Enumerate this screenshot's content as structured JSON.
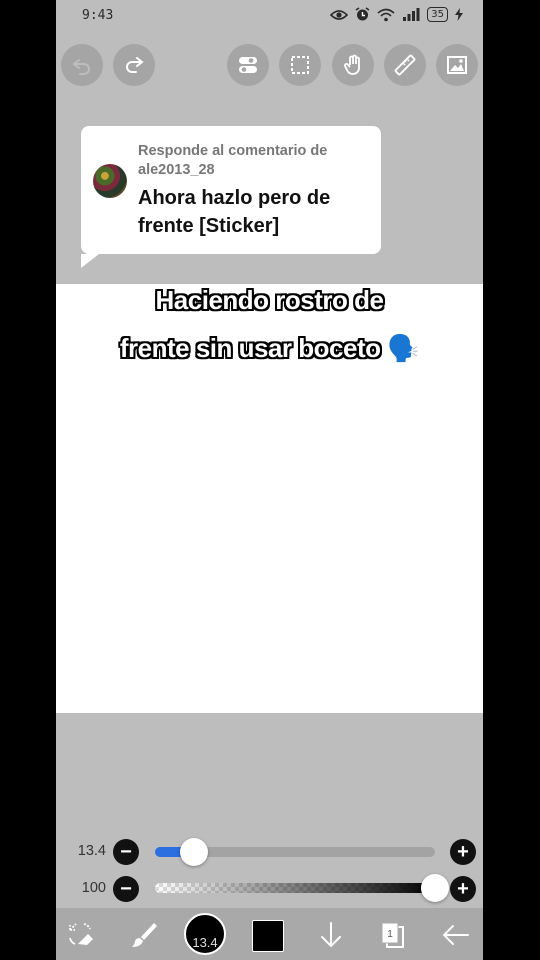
{
  "status_bar": {
    "time": "9:43",
    "battery": "35"
  },
  "comment": {
    "reply_label": "Responde al comentario de ale2013_28",
    "text": "Ahora hazlo pero de frente [Sticker]"
  },
  "overlay_text": {
    "line1": "Haciendo rostro de",
    "line2": "frente sin usar boceto",
    "emoji": "🗣️"
  },
  "brush": {
    "size_label": "13.4",
    "size_fraction": 0.08,
    "opacity_label": "100",
    "opacity_fraction": 1.0
  },
  "bottom_bar": {
    "brush_size_badge": "13.4",
    "layers_badge": "1"
  },
  "colors": {
    "accent": "#2c6fe0",
    "toolbar_bg": "#a5a5a5",
    "canvas_bg": "#ffffff",
    "workspace_bg": "#bdbdbd"
  }
}
